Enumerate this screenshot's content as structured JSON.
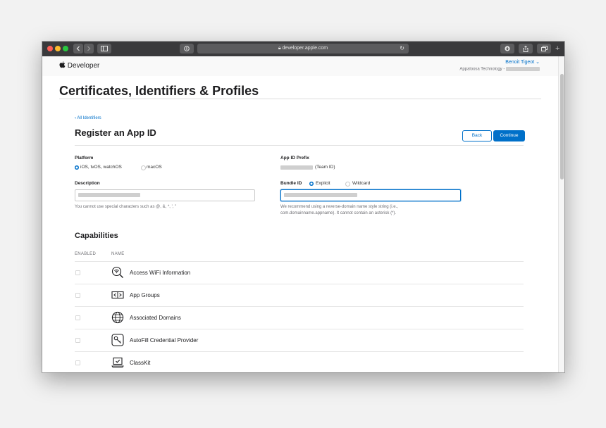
{
  "browser": {
    "url": "developer.apple.com",
    "new_tab": "+"
  },
  "header": {
    "brand": "Developer",
    "user_name": "Benoit Tigeot",
    "team_name": "Appaloosa Technology -"
  },
  "page_title": "Certificates, Identifiers & Profiles",
  "register": {
    "back_link": "‹ All Identifiers",
    "title": "Register an App ID",
    "back_button": "Back",
    "continue_button": "Continue",
    "platform_label": "Platform",
    "platform_options": [
      "iOS, tvOS, watchOS",
      "macOS"
    ],
    "prefix_label": "App ID Prefix",
    "prefix_suffix": "(Team ID)",
    "description_label": "Description",
    "description_hint": "You cannot use special characters such as @, &, *, ', \"",
    "bundle_label": "Bundle ID",
    "bundle_options": [
      "Explicit",
      "Wildcard"
    ],
    "bundle_hint_1": "We recommend using a reverse-domain name style string (i.e.,",
    "bundle_hint_2": "com.domainname.appname). It cannot contain an asterisk (*)."
  },
  "capabilities": {
    "title": "Capabilities",
    "col_enabled": "ENABLED",
    "col_name": "NAME",
    "items": [
      {
        "name": "Access WiFi Information",
        "icon": "wifi-magnifier-icon"
      },
      {
        "name": "App Groups",
        "icon": "app-groups-icon"
      },
      {
        "name": "Associated Domains",
        "icon": "globe-icon"
      },
      {
        "name": "AutoFill Credential Provider",
        "icon": "key-icon"
      },
      {
        "name": "ClassKit",
        "icon": "laptop-check-icon"
      }
    ]
  },
  "colors": {
    "accent": "#0070c9",
    "toolbar": "#3a3a3c"
  }
}
